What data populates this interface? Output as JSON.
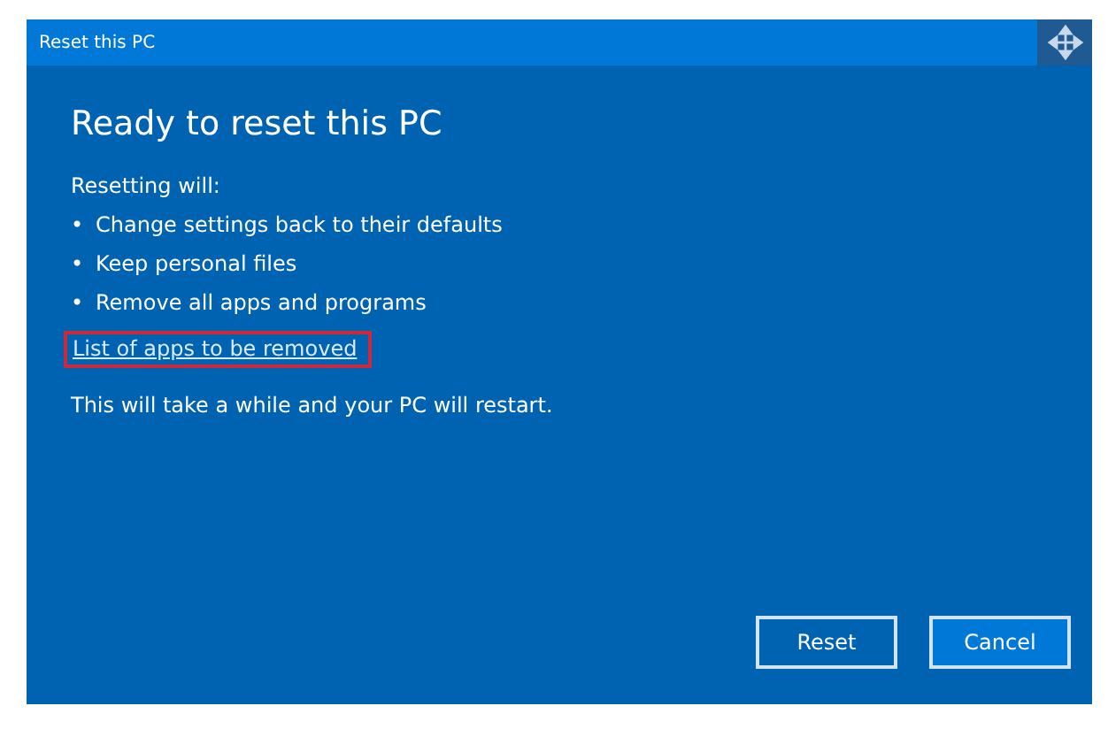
{
  "window": {
    "title": "Reset this PC"
  },
  "heading": "Ready to reset this PC",
  "intro": "Resetting will:",
  "bullets": [
    {
      "mark": "•",
      "text": "Change settings back to their defaults"
    },
    {
      "mark": "•",
      "text": "Keep personal files"
    },
    {
      "mark": "•",
      "text": "Remove all apps and programs"
    }
  ],
  "link": {
    "label": "List of apps to be removed",
    "highlighted": true
  },
  "note": "This will take a while and your PC will restart.",
  "buttons": [
    {
      "label": "Reset",
      "focused": false
    },
    {
      "label": "Cancel",
      "focused": true
    }
  ]
}
